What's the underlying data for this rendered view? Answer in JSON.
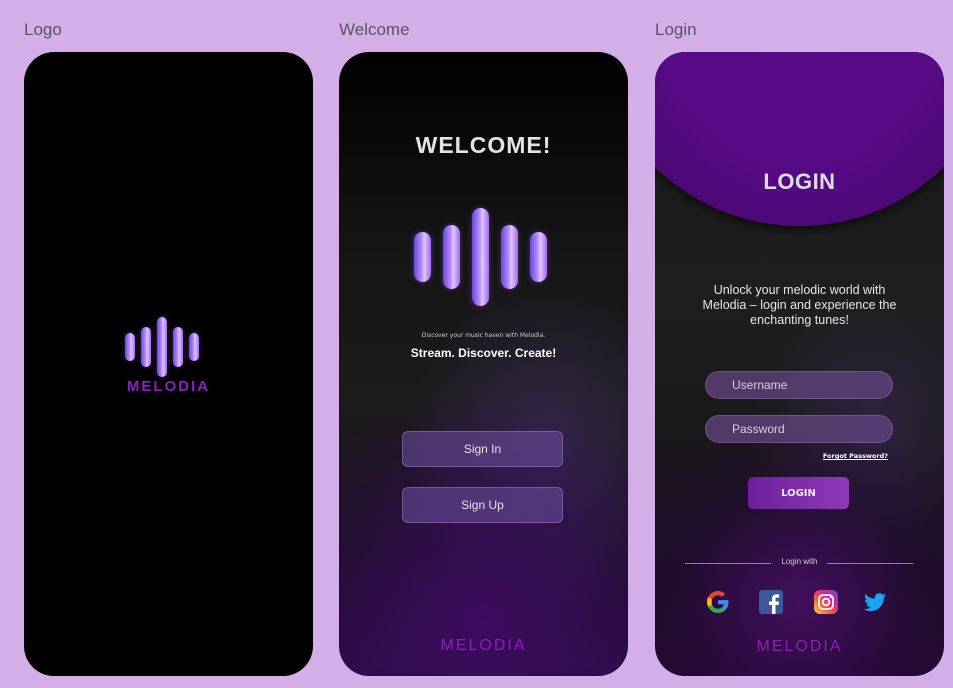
{
  "frames": {
    "logo": {
      "label": "Logo"
    },
    "welcome": {
      "label": "Welcome"
    },
    "login": {
      "label": "Login"
    }
  },
  "brand": {
    "wordmark": "MELODIA"
  },
  "welcome": {
    "title": "WELCOME!",
    "discover_text": "Discover your music haven with Melodia.",
    "tagline": "Stream. Discover. Create!",
    "sign_in_label": "Sign In",
    "sign_up_label": "Sign Up"
  },
  "login": {
    "title": "LOGIN",
    "description": "Unlock your melodic world with Melodia – login and experience the enchanting tunes!",
    "username_placeholder": "Username",
    "password_placeholder": "Password",
    "forgot_password": "Forgot Password?",
    "login_button": "LOGIN",
    "login_with": "Login with",
    "social": [
      "google-icon",
      "facebook-icon",
      "instagram-icon",
      "twitter-icon"
    ]
  },
  "colors": {
    "page_background": "#d4aee6",
    "brand_purple": "#8f1ec4",
    "bar_gradient_start": "#6a48d8",
    "bar_gradient_end": "#e3c6ff"
  }
}
